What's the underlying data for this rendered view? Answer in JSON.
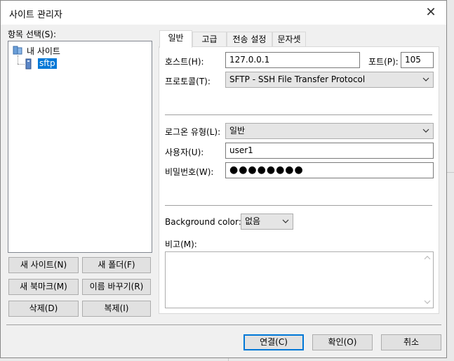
{
  "window": {
    "title": "사이트 관리자",
    "close_glyph": "✕"
  },
  "left": {
    "select_label": "항목 선택(S):",
    "tree": {
      "root": "내 사이트",
      "child": "sftp"
    },
    "buttons": {
      "new_site": "새 사이트(N)",
      "new_folder": "새 폴더(F)",
      "new_bookmark": "새 북마크(M)",
      "rename": "이름 바꾸기(R)",
      "delete": "삭제(D)",
      "copy": "복제(I)"
    }
  },
  "tabs": [
    "일반",
    "고급",
    "전송 설정",
    "문자셋"
  ],
  "general": {
    "host_label": "호스트(H):",
    "host_value": "127.0.0.1",
    "port_label": "포트(P):",
    "port_value": "105",
    "protocol_label": "프로토콜(T):",
    "protocol_value": "SFTP - SSH File Transfer Protocol",
    "logon_label": "로그온 유형(L):",
    "logon_value": "일반",
    "user_label": "사용자(U):",
    "user_value": "user1",
    "password_label": "비밀번호(W):",
    "password_value": "●●●●●●●●",
    "bgcolor_label": "Background color:",
    "bgcolor_value": "없음",
    "comments_label": "비고(M):"
  },
  "footer": {
    "connect": "연결(C)",
    "ok": "확인(O)",
    "cancel": "취소"
  },
  "colors": {
    "selection": "#0078d7",
    "accent_border": "#0078d7"
  }
}
